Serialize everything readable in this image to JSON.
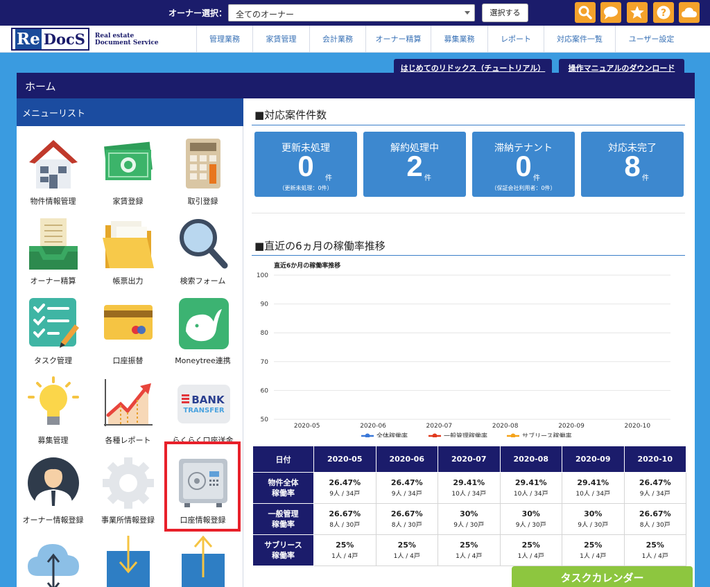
{
  "topbar": {
    "owner_label": "オーナー選択：",
    "owner_selected": "全てのオーナー",
    "select_button": "選択する",
    "icons": [
      "search-icon",
      "chat-icon",
      "star-icon",
      "help-icon",
      "cloud-icon"
    ]
  },
  "logo": {
    "re": "Re",
    "docs": "DocS",
    "sub1": "Real estate",
    "sub2": "Document Service"
  },
  "nav": [
    "管理業務",
    "家賃管理",
    "会計業務",
    "オーナー精算",
    "募集業務",
    "レポート",
    "対応案件一覧",
    "ユーザー設定"
  ],
  "tabs": {
    "tutorial": "はじめてのリドックス（チュートリアル）",
    "manual": "操作マニュアルのダウンロード"
  },
  "home_title": "ホーム",
  "menu": {
    "header": "メニューリスト",
    "items": [
      {
        "label": "物件情報管理",
        "icon": "house-icon"
      },
      {
        "label": "家賃登録",
        "icon": "banknotes-icon"
      },
      {
        "label": "取引登録",
        "icon": "calculator-icon"
      },
      {
        "label": "オーナー精算",
        "icon": "inbox-tray-icon"
      },
      {
        "label": "帳票出力",
        "icon": "folder-icon"
      },
      {
        "label": "検索フォーム",
        "icon": "magnifier-icon"
      },
      {
        "label": "タスク管理",
        "icon": "checklist-icon"
      },
      {
        "label": "口座振替",
        "icon": "credit-card-icon"
      },
      {
        "label": "Moneytree連携",
        "icon": "moneytree-icon"
      },
      {
        "label": "募集管理",
        "icon": "lightbulb-icon"
      },
      {
        "label": "各種レポート",
        "icon": "growth-chart-icon"
      },
      {
        "label": "らくらく口座送金",
        "icon": "bank-transfer-icon"
      },
      {
        "label": "オーナー情報登録",
        "icon": "owner-avatar-icon"
      },
      {
        "label": "事業所情報登録",
        "icon": "gear-icon"
      },
      {
        "label": "口座情報登録",
        "icon": "safe-icon"
      },
      {
        "label": "",
        "icon": "cloud-sync-icon"
      },
      {
        "label": "",
        "icon": "download-box-icon"
      },
      {
        "label": "",
        "icon": "upload-box-icon"
      }
    ],
    "bank_text1": "BANK",
    "bank_text2": "TRANSFER"
  },
  "cases": {
    "title": "■対応案件件数",
    "unit": "件",
    "cards": [
      {
        "title": "更新未処理",
        "value": "0",
        "note": "（更新未処理：0件）"
      },
      {
        "title": "解約処理中",
        "value": "2",
        "note": ""
      },
      {
        "title": "滞納テナント",
        "value": "0",
        "note": "（保証会社利用者：0件）"
      },
      {
        "title": "対応未完了",
        "value": "8",
        "note": ""
      }
    ]
  },
  "occupancy": {
    "title": "■直近の6ヵ月の稼働率推移"
  },
  "chart_data": {
    "type": "line",
    "title": "直近6か月の稼働率推移",
    "x": [
      "2020-05",
      "2020-06",
      "2020-07",
      "2020-08",
      "2020-09",
      "2020-10"
    ],
    "ylim": [
      50,
      100
    ],
    "yticks": [
      "100",
      "90",
      "80",
      "70",
      "60",
      "50"
    ],
    "series": [
      {
        "name": "全体稼働率",
        "color": "#3a78d8",
        "values": []
      },
      {
        "name": "一般管理稼働率",
        "color": "#e03a1e",
        "values": []
      },
      {
        "name": "サブリース稼働率",
        "color": "#f5a31a",
        "values": []
      }
    ],
    "legend": "bottom",
    "grid": true
  },
  "table": {
    "date_header": "日付",
    "columns": [
      "2020-05",
      "2020-06",
      "2020-07",
      "2020-08",
      "2020-09",
      "2020-10"
    ],
    "rows": [
      {
        "label1": "物件全体",
        "label2": "稼働率",
        "cells": [
          {
            "pct": "26.47%",
            "cnt": "9人 / 34戸"
          },
          {
            "pct": "26.47%",
            "cnt": "9人 / 34戸"
          },
          {
            "pct": "29.41%",
            "cnt": "10人 / 34戸"
          },
          {
            "pct": "29.41%",
            "cnt": "10人 / 34戸"
          },
          {
            "pct": "29.41%",
            "cnt": "10人 / 34戸"
          },
          {
            "pct": "26.47%",
            "cnt": "9人 / 34戸"
          }
        ]
      },
      {
        "label1": "一般管理",
        "label2": "稼働率",
        "cells": [
          {
            "pct": "26.67%",
            "cnt": "8人 / 30戸"
          },
          {
            "pct": "26.67%",
            "cnt": "8人 / 30戸"
          },
          {
            "pct": "30%",
            "cnt": "9人 / 30戸"
          },
          {
            "pct": "30%",
            "cnt": "9人 / 30戸"
          },
          {
            "pct": "30%",
            "cnt": "9人 / 30戸"
          },
          {
            "pct": "26.67%",
            "cnt": "8人 / 30戸"
          }
        ]
      },
      {
        "label1": "サブリース",
        "label2": "稼働率",
        "cells": [
          {
            "pct": "25%",
            "cnt": "1人 / 4戸"
          },
          {
            "pct": "25%",
            "cnt": "1人 / 4戸"
          },
          {
            "pct": "25%",
            "cnt": "1人 / 4戸"
          },
          {
            "pct": "25%",
            "cnt": "1人 / 4戸"
          },
          {
            "pct": "25%",
            "cnt": "1人 / 4戸"
          },
          {
            "pct": "25%",
            "cnt": "1人 / 4戸"
          }
        ]
      }
    ]
  },
  "task_calendar": "タスクカレンダー"
}
